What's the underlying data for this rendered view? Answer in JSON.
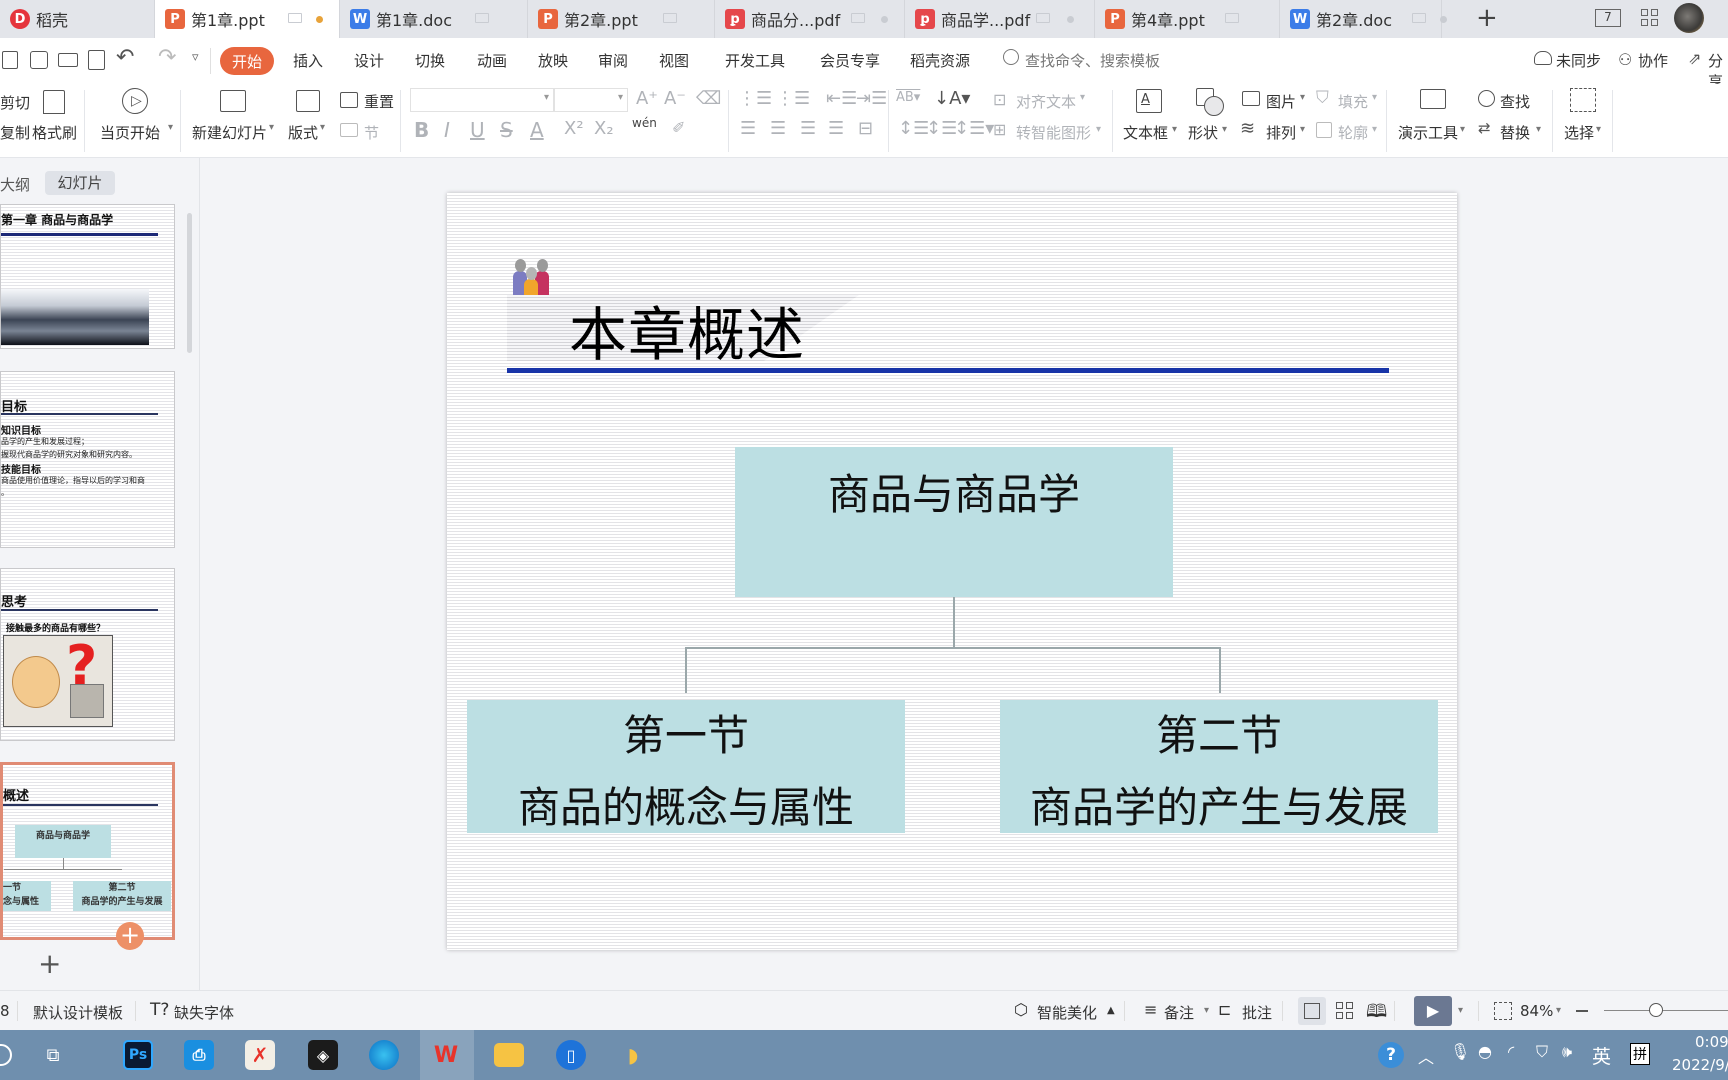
{
  "tabs": [
    {
      "label": "稻壳",
      "icon": "docer-icon",
      "color": "#e5353d"
    },
    {
      "label": "第1章.ppt",
      "icon": "ppt-icon",
      "color": "#e8663e",
      "active": true,
      "modified": true
    },
    {
      "label": "第1章.doc",
      "icon": "doc-icon",
      "color": "#3b7ce8"
    },
    {
      "label": "第2章.ppt",
      "icon": "ppt-icon",
      "color": "#e8663e"
    },
    {
      "label": "商品分...pdf",
      "icon": "pdf-icon",
      "color": "#e5474b"
    },
    {
      "label": "商品学...pdf",
      "icon": "pdf-icon",
      "color": "#e5474b"
    },
    {
      "label": "第4章.ppt",
      "icon": "ppt-icon",
      "color": "#e8663e"
    },
    {
      "label": "第2章.doc",
      "icon": "doc-icon",
      "color": "#3b7ce8"
    }
  ],
  "tabbar_right": {
    "add": "+",
    "window_count": "7"
  },
  "menu": {
    "items": [
      "开始",
      "插入",
      "设计",
      "切换",
      "动画",
      "放映",
      "审阅",
      "视图",
      "开发工具",
      "会员专享",
      "稻壳资源"
    ],
    "active": "开始",
    "search_placeholder": "查找命令、搜索模板",
    "sync": "未同步",
    "collab": "协作",
    "share": "分享"
  },
  "ribbon": {
    "cut": "剪切",
    "copy": "复制",
    "format_painter": "格式刷",
    "play_from_current": "当页开始",
    "new_slide": "新建幻灯片",
    "layout": "版式",
    "reset": "重置",
    "section": "节",
    "align_text": "对齐文本",
    "smartart": "转智能图形",
    "textbox": "文本框",
    "shape": "形状",
    "picture": "图片",
    "fill": "填充",
    "arrange": "排列",
    "outline": "轮廓",
    "present_tools": "演示工具",
    "find": "查找",
    "replace": "替换",
    "select": "选择",
    "font_name": "",
    "font_size": ""
  },
  "panel": {
    "tab_outline": "大纲",
    "tab_slides": "幻灯片",
    "thumbs": [
      {
        "title": "第一章   商品与商品学"
      },
      {
        "title": "目标",
        "lines": [
          "知识目标",
          "品学的产生和发展过程；",
          "握现代商品学的研究对象和研究内容。",
          "技能目标",
          "商品使用价值理论，指导以后的学习和商",
          "。"
        ]
      },
      {
        "title": "思考",
        "question": "接触最多的商品有哪些？"
      },
      {
        "title": "概述",
        "root": "商品与商品学",
        "left": [
          "一节",
          "念与属性"
        ],
        "right": [
          "第二节",
          "商品学的产生与发展"
        ]
      }
    ]
  },
  "slide": {
    "title": "本章概述",
    "root": "商品与商品学",
    "left": {
      "line1": "第一节",
      "line2": "商品的概念与属性"
    },
    "right": {
      "line1": "第二节",
      "line2": "商品学的产生与发展"
    }
  },
  "status": {
    "slide_count_partial": "8",
    "template": "默认设计模板",
    "missing_font": "缺失字体",
    "beautify": "智能美化",
    "notes": "备注",
    "comment": "批注",
    "zoom": "84%",
    "zoom_fraction": 0.84
  },
  "taskbar": {
    "time": "0:09",
    "date": "2022/9/",
    "ime_lang": "英",
    "ime_mode": "拼"
  }
}
